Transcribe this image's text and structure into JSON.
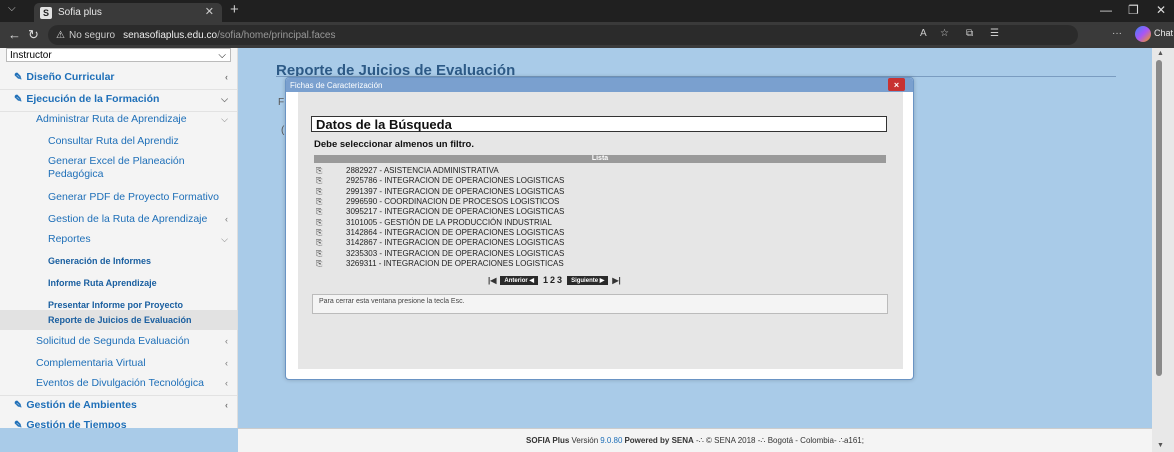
{
  "browser": {
    "tab_title": "Sofia plus",
    "favicon_text": "S",
    "url_warning": "No seguro",
    "url_host": "senasofiaplus.edu.co",
    "url_path": "/sofia/home/principal.faces",
    "chat_label": "Chat"
  },
  "sidebar": {
    "role_select": "Instructor",
    "items": [
      {
        "label": "Diseño Curricular",
        "level": 1
      },
      {
        "label": "Ejecución de la Formación",
        "level": 1
      },
      {
        "label": "Administrar Ruta de Aprendizaje",
        "level": 2
      },
      {
        "label": "Consultar Ruta del Aprendiz",
        "level": 3
      },
      {
        "label": "Generar Excel de Planeación Pedagógica",
        "level": 3
      },
      {
        "label": "Generar PDF de Proyecto Formativo",
        "level": 3
      },
      {
        "label": "Gestion de la Ruta de Aprendizaje",
        "level": 3
      },
      {
        "label": "Reportes",
        "level": 3
      },
      {
        "label": "Generación de Informes",
        "level": 4
      },
      {
        "label": "Informe Ruta Aprendizaje",
        "level": 4
      },
      {
        "label": "Presentar Informe por Proyecto",
        "level": 4
      },
      {
        "label": "Reporte de Juicios de Evaluación",
        "level": 4,
        "active": true
      },
      {
        "label": "Solicitud de Segunda Evaluación",
        "level": 2
      },
      {
        "label": "Complementaria Virtual",
        "level": 2
      },
      {
        "label": "Eventos de Divulgación Tecnológica",
        "level": 2
      },
      {
        "label": "Gestión de Ambientes",
        "level": 1
      },
      {
        "label": "Gestión de Tiempos",
        "level": 1
      }
    ]
  },
  "main": {
    "title": "Reporte de Juicios de Evaluación",
    "frag_f": "F",
    "frag_c": "("
  },
  "modal": {
    "header": "Fichas de Caracterización",
    "close": "×",
    "search_title": "Datos de la Búsqueda",
    "filter_msg": "Debe seleccionar almenos un filtro.",
    "list_header": "Lista",
    "rows": [
      "2882927 - ASISTENCIA ADMINISTRATIVA",
      "2925786 - INTEGRACION DE OPERACIONES LOGISTICAS",
      "2991397 - INTEGRACION DE OPERACIONES LOGISTICAS",
      "2996590 - COORDINACION DE PROCESOS LOGISTICOS",
      "3095217 - INTEGRACION DE OPERACIONES LOGISTICAS",
      "3101005 - GESTIÓN DE LA PRODUCCIÓN INDUSTRIAL",
      "3142864 - INTEGRACION DE OPERACIONES LOGISTICAS",
      "3142867 - INTEGRACION DE OPERACIONES LOGISTICAS",
      "3235303 - INTEGRACION DE OPERACIONES LOGISTICAS",
      "3269311 - INTEGRACION DE OPERACIONES LOGISTICAS"
    ],
    "pager": {
      "prev": "Anterior ◀",
      "pages": [
        "1",
        "2",
        "3"
      ],
      "next": "Siguiente ▶"
    },
    "esc_note": "Para cerrar esta ventana presione la tecla Esc."
  },
  "footer": {
    "prefix": "SOFIA Plus",
    "version_label": "Versión",
    "version": "9.0.80",
    "powered": "Powered by SENA",
    "rest": "-∴ © SENA 2018 -∴ Bogotá - Colombia- ∴a161;"
  }
}
